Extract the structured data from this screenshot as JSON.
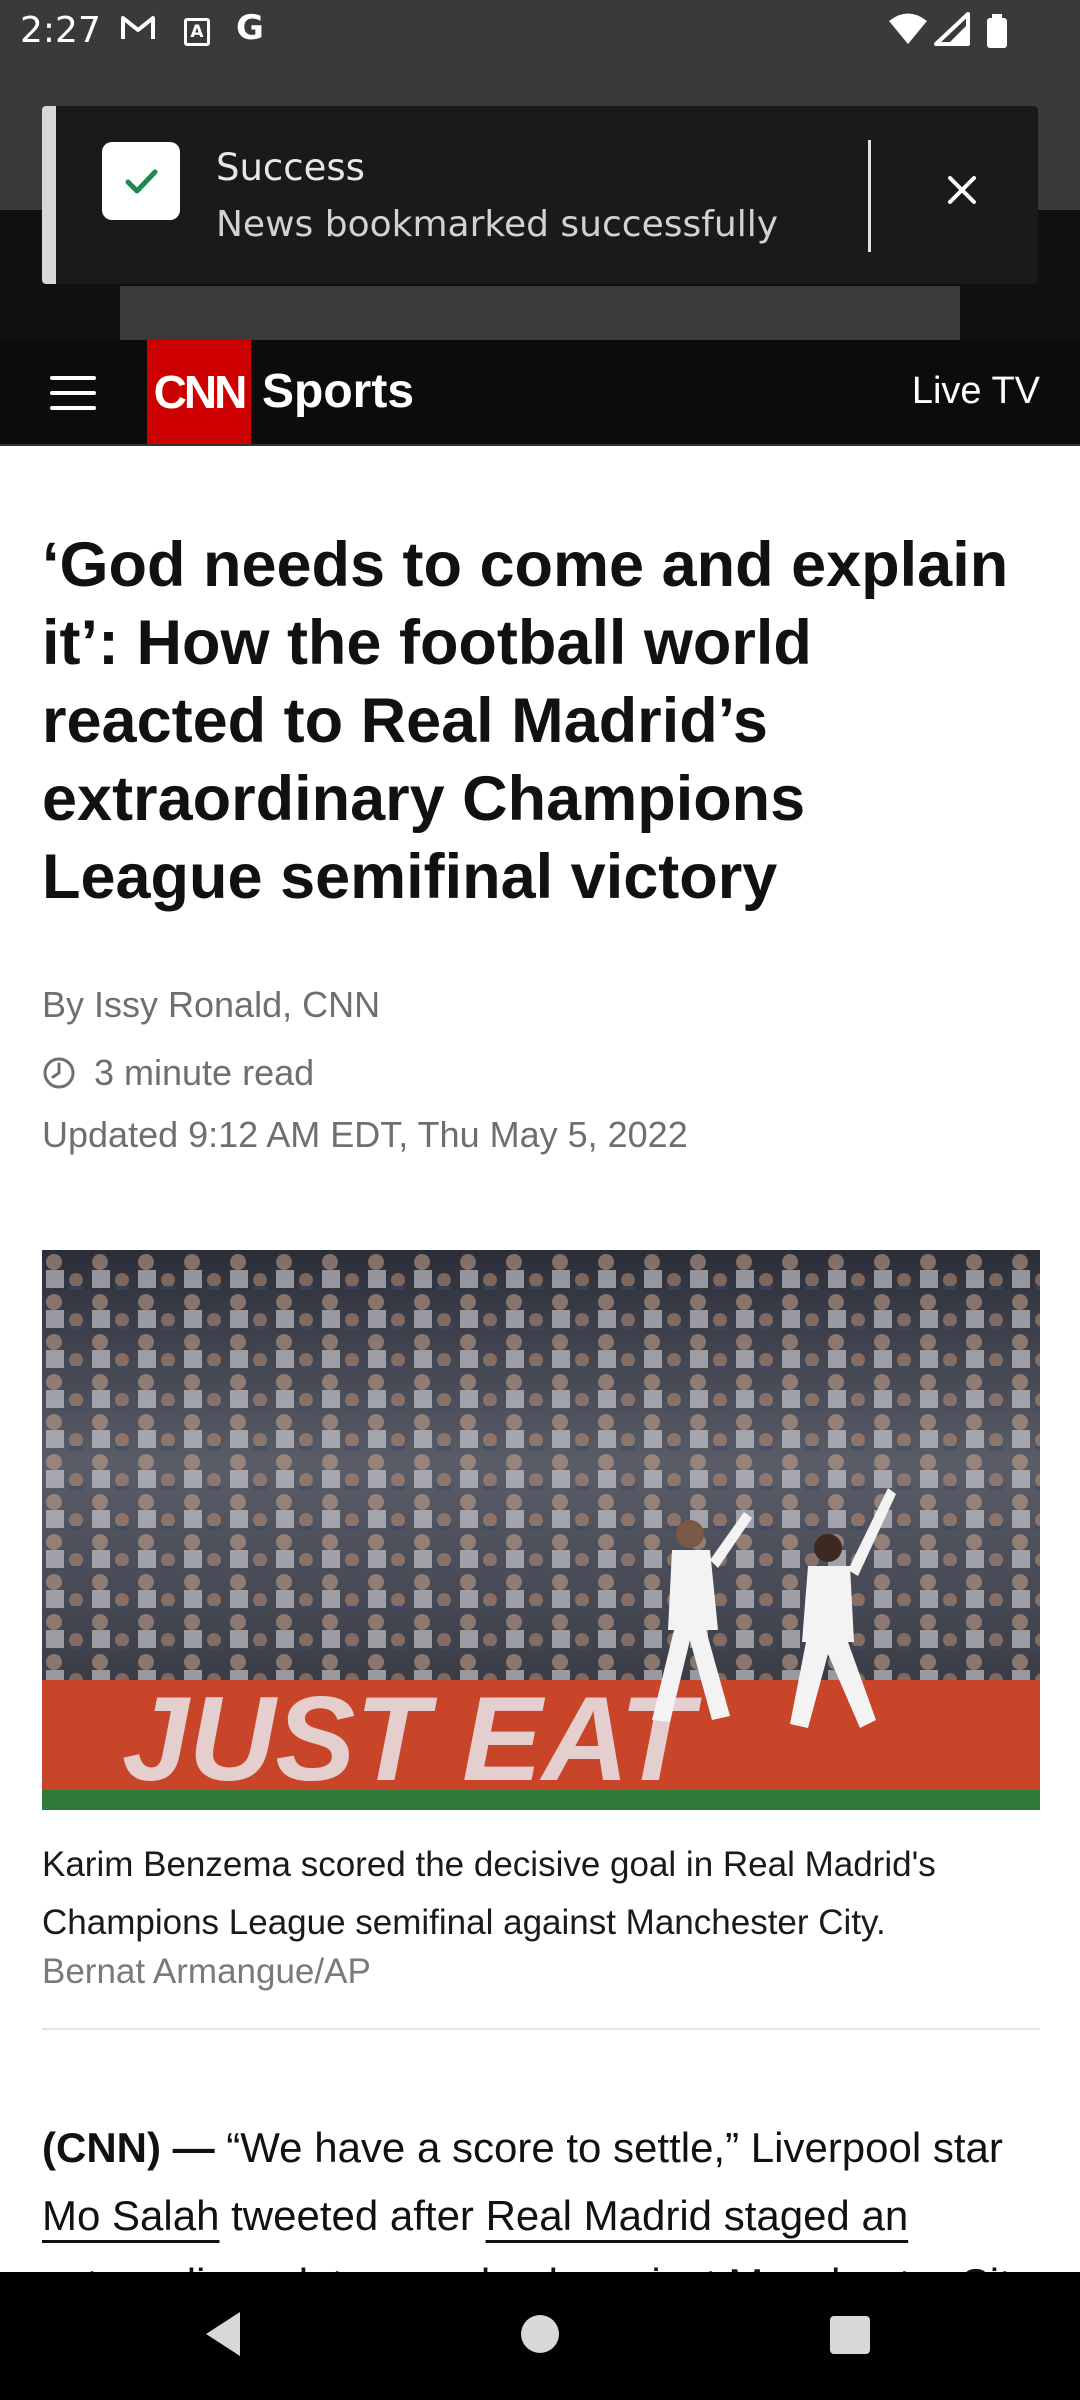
{
  "status_bar": {
    "time": "2:27",
    "icons": [
      "gmail-icon",
      "a-box-icon",
      "google-icon",
      "wifi-icon",
      "signal-icon",
      "battery-icon"
    ]
  },
  "toast": {
    "title": "Success",
    "message": "News bookmarked successfully",
    "icons": [
      "check-icon",
      "close-icon"
    ]
  },
  "header": {
    "logo_text": "CNN",
    "section": "Sports",
    "live_tv": "Live TV",
    "brand_color": "#cc0000"
  },
  "article": {
    "headline": "‘God needs to come and explain it’: How the football world reacted to Real Madrid’s extraordinary Champions League semifinal victory",
    "byline": "By Issy Ronald, CNN",
    "read_time": "3 minute read",
    "updated": "Updated 9:12 AM EDT, Thu May 5, 2022",
    "image": {
      "banner_text": "JUST EAT",
      "caption": "Karim Benzema scored the decisive goal in Real Madrid's Champions League semifinal against Manchester City.",
      "credit": "Bernat Armangue/AP"
    },
    "body": {
      "lead": "(CNN) —",
      "text1": " “We have a score to settle,” Liverpool star ",
      "link1": "Mo Salah",
      "text2": " tweeted after ",
      "link2": "Real Madrid staged an extraordinary late comeback against Manchester",
      "text3": " City"
    }
  },
  "nav_bar": {
    "buttons": [
      "back-button",
      "home-button",
      "recents-button"
    ]
  }
}
